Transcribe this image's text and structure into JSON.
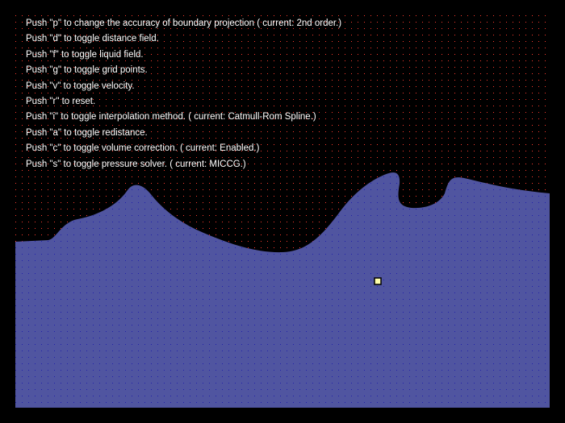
{
  "colors": {
    "background": "#000000",
    "liquid": "#5055a0",
    "liquid_grid_point": "#2020a8",
    "air_grid_point": "#ff3b2e",
    "text": "#ffffff",
    "particle_fill": "#ffffaa",
    "particle_border": "#000000"
  },
  "help_lines": [
    {
      "key": "p",
      "text": "Push \"p\" to change the accuracy of boundary projection ( current: 2nd order.)"
    },
    {
      "key": "d",
      "text": "Push \"d\" to toggle distance field."
    },
    {
      "key": "f",
      "text": "Push \"f\" to toggle liquid field."
    },
    {
      "key": "g",
      "text": "Push \"g\" to toggle grid points."
    },
    {
      "key": "v",
      "text": "Push \"v\" to toggle velocity."
    },
    {
      "key": "r",
      "text": "Push \"r\" to reset."
    },
    {
      "key": "i",
      "text": "Push \"i\" to toggle interpolation method. ( current: Catmull-Rom Spline.)"
    },
    {
      "key": "a",
      "text": "Push \"a\" to toggle redistance."
    },
    {
      "key": "c",
      "text": "Push \"c\" to toggle volume correction. ( current: Enabled.)"
    },
    {
      "key": "s",
      "text": "Push \"s\" to toggle pressure solver. ( current: MICCG.)"
    }
  ]
}
